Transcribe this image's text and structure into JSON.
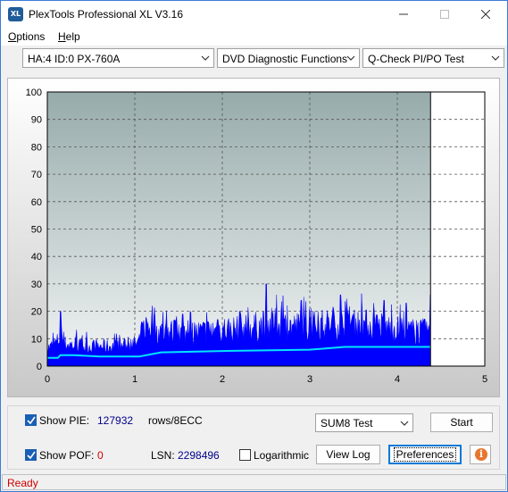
{
  "window": {
    "title": "PlexTools Professional XL V3.16",
    "icon_text": "XL",
    "buttons": [
      "minimize-icon",
      "maximize-icon",
      "close-icon"
    ]
  },
  "menu": {
    "items": [
      {
        "label": "Options",
        "accel": "O"
      },
      {
        "label": "Help",
        "accel": "H"
      }
    ]
  },
  "toolbar": {
    "drive": "HA:4 ID:0  PX-760A",
    "function": "DVD Diagnostic Functions",
    "test": "Q-Check PI/PO Test"
  },
  "chart_data": {
    "type": "area",
    "x_ticks": [
      "0",
      "1",
      "2",
      "3",
      "4",
      "5"
    ],
    "y_ticks": [
      "0",
      "10",
      "20",
      "30",
      "40",
      "50",
      "60",
      "70",
      "80",
      "90",
      "100"
    ],
    "xlim": [
      0,
      5
    ],
    "ylim": [
      0,
      100
    ],
    "grid": true,
    "scan_end_x": 4.38,
    "colors": {
      "pie": "#0000ff",
      "pof": "#00e5ff",
      "plot_bg_top": "#97abab",
      "plot_bg_bottom": "#f2f4f4",
      "unscanned": "#ffffff"
    },
    "series": [
      {
        "id": "pie",
        "x": [
          0.0,
          0.05,
          0.12,
          0.15,
          0.2,
          0.4,
          0.6,
          0.8,
          1.0,
          1.05,
          1.1,
          1.15,
          1.25,
          1.4,
          1.6,
          1.8,
          2.0,
          2.2,
          2.4,
          2.5,
          2.6,
          2.8,
          3.0,
          3.2,
          3.4,
          3.6,
          3.8,
          4.0,
          4.2,
          4.33,
          4.38
        ],
        "y": [
          7,
          8,
          10,
          12,
          9,
          8,
          8,
          8,
          9,
          10,
          15,
          17,
          14,
          14,
          13,
          14,
          15,
          15,
          16,
          17,
          17,
          16,
          16,
          17,
          17,
          17,
          16,
          15,
          14,
          14,
          15
        ],
        "peaks": [
          {
            "x": 0.15,
            "y": 20
          },
          {
            "x": 1.2,
            "y": 22
          },
          {
            "x": 1.55,
            "y": 19
          },
          {
            "x": 1.95,
            "y": 17
          },
          {
            "x": 2.2,
            "y": 20
          },
          {
            "x": 2.5,
            "y": 30
          },
          {
            "x": 2.62,
            "y": 26
          },
          {
            "x": 2.9,
            "y": 24
          },
          {
            "x": 3.35,
            "y": 26
          },
          {
            "x": 3.6,
            "y": 20
          },
          {
            "x": 3.85,
            "y": 24
          },
          {
            "x": 4.1,
            "y": 23
          },
          {
            "x": 4.38,
            "y": 26
          }
        ]
      },
      {
        "id": "pof",
        "x": [
          0.0,
          0.12,
          0.15,
          0.3,
          0.6,
          1.0,
          1.05,
          1.3,
          2.0,
          3.0,
          3.4,
          4.0,
          4.38
        ],
        "y": [
          3,
          3,
          4,
          4,
          3.5,
          3.5,
          3.5,
          5,
          5.5,
          6,
          7,
          7,
          7
        ]
      }
    ]
  },
  "bottom_panel": {
    "show_pie": {
      "label": "Show PIE:",
      "checked": true,
      "value": "127932"
    },
    "rows_label": "rows/8ECC",
    "show_pof": {
      "label": "Show POF:",
      "checked": true,
      "value": "0"
    },
    "lsn_label": "LSN:",
    "lsn_value": "2298496",
    "logarithmic": {
      "label": "Logarithmic",
      "checked": false
    },
    "test_select": "SUM8 Test",
    "start_button": "Start",
    "view_log_button": "View Log",
    "preferences_button": "Preferences",
    "info_icon": "i"
  },
  "status": {
    "text": "Ready"
  }
}
